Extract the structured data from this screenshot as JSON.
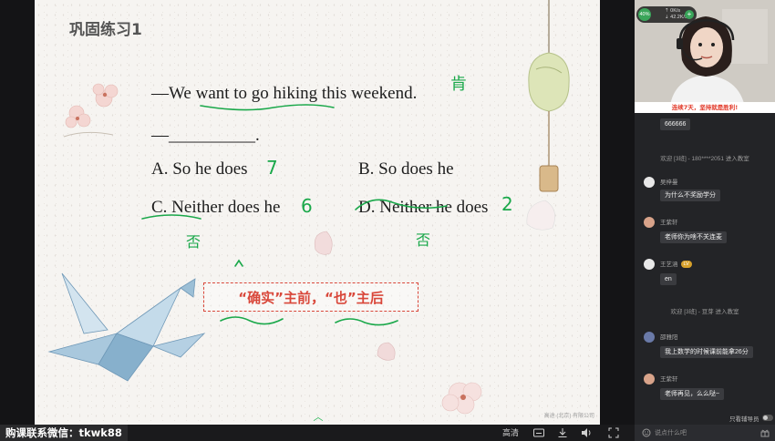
{
  "slide": {
    "title": "巩固练习1",
    "question": "—We want to go hiking this weekend.",
    "answer_blank": "—__________.",
    "options": [
      {
        "text": "A. So he does"
      },
      {
        "text": "B. So does he"
      },
      {
        "text": "C. Neither does he"
      },
      {
        "text": "D. Neither he does"
      }
    ],
    "tip": "“确实”主前，“也”主后",
    "handwriting": {
      "mark_question": "肯",
      "mark_a": "7",
      "mark_c": "6",
      "mark_d": "2",
      "below_c": "否",
      "below_d": "否"
    },
    "watermark": "高途 (北京) 有限公司"
  },
  "toolbar": {
    "contact": "购课联系微信：tkwk88",
    "quality": "高清"
  },
  "video": {
    "cpu": "40%",
    "up_speed": "0K/s",
    "down_speed": "42.2K/s",
    "banner": "连续7天，坚持就是胜利!"
  },
  "chat": {
    "first_message": "666666",
    "messages": [
      {
        "type": "system",
        "text": "欢迎 [3班] - 180****2051 进入教室"
      },
      {
        "type": "user",
        "name": "吴梓曼",
        "text": "为什么不奖励学分",
        "avatar_color": "#e8e8e8"
      },
      {
        "type": "user",
        "name": "王紫轩",
        "text": "老师你为啥不关连麦",
        "avatar_color": "#d8a38a"
      },
      {
        "type": "user",
        "name": "王艺涵",
        "badge": "LV",
        "text": "en",
        "avatar_color": "#e8e8e8"
      },
      {
        "type": "system",
        "text": "欢迎 [3班] - 豆芽 进入教室"
      },
      {
        "type": "user",
        "name": "邵雅阳",
        "text": "我上数学的时候课前能拿26分",
        "avatar_color": "#6a7aa8"
      },
      {
        "type": "user",
        "name": "王紫轩",
        "text": "老师再见，么么哒~",
        "avatar_color": "#d8a38a"
      }
    ],
    "only_teacher": "只看辅导员",
    "input_placeholder": "说点什么吧"
  }
}
